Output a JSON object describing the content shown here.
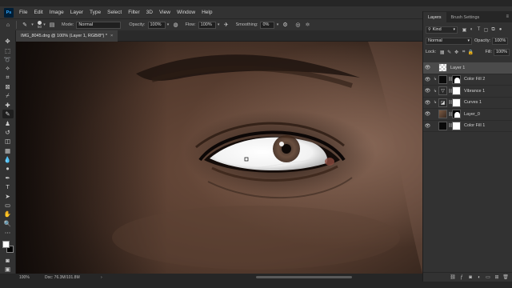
{
  "app": {
    "logo": "Ps"
  },
  "menu": [
    "File",
    "Edit",
    "Image",
    "Layer",
    "Type",
    "Select",
    "Filter",
    "3D",
    "View",
    "Window",
    "Help"
  ],
  "options": {
    "brush_size": "50",
    "mode_label": "Mode:",
    "mode_value": "Normal",
    "opacity_label": "Opacity:",
    "opacity_value": "100%",
    "flow_label": "Flow:",
    "flow_value": "100%",
    "smoothing_label": "Smoothing:",
    "smoothing_value": "0%"
  },
  "document": {
    "tab_title": "IMG_8045.dng @ 100% (Layer 1, RGB/8*) *",
    "close_glyph": "×"
  },
  "status": {
    "zoom": "100%",
    "doc_info": "Doc: 76.3M/101.8M"
  },
  "panel": {
    "tabs": [
      "Layers",
      "Brush Settings"
    ],
    "menu_glyph": "≡",
    "kind_label": "Kind",
    "blend_mode": "Normal",
    "opacity_label": "Opacity:",
    "opacity_value": "100%",
    "lock_label": "Lock:",
    "fill_label": "Fill:",
    "fill_value": "100%"
  },
  "layers": [
    {
      "name": "Layer 1",
      "thumb": "checker",
      "mask": "",
      "clipped": false,
      "selected": true
    },
    {
      "name": "Color Fill 2",
      "thumb": "black",
      "mask": "mask-face",
      "clipped": true,
      "selected": false
    },
    {
      "name": "Vibrance 1",
      "thumb": "adj",
      "thumb_glyph": "▽",
      "mask": "white",
      "clipped": true,
      "selected": false
    },
    {
      "name": "Curves 1",
      "thumb": "adj",
      "thumb_glyph": "◪",
      "mask": "white",
      "clipped": true,
      "selected": false
    },
    {
      "name": "Layer_0",
      "thumb": "photo",
      "mask": "mask-face",
      "clipped": false,
      "selected": false
    },
    {
      "name": "Color Fill 1",
      "thumb": "black",
      "mask": "white",
      "clipped": false,
      "selected": false
    }
  ],
  "footer_icons": [
    "link-icon",
    "fx-icon",
    "mask-icon",
    "adjustment-icon",
    "group-icon",
    "new-layer-icon",
    "trash-icon"
  ],
  "colors": {
    "foreground": "#ffffff",
    "background": "#000000",
    "ui_dark": "#323232",
    "ui_darker": "#262626"
  }
}
